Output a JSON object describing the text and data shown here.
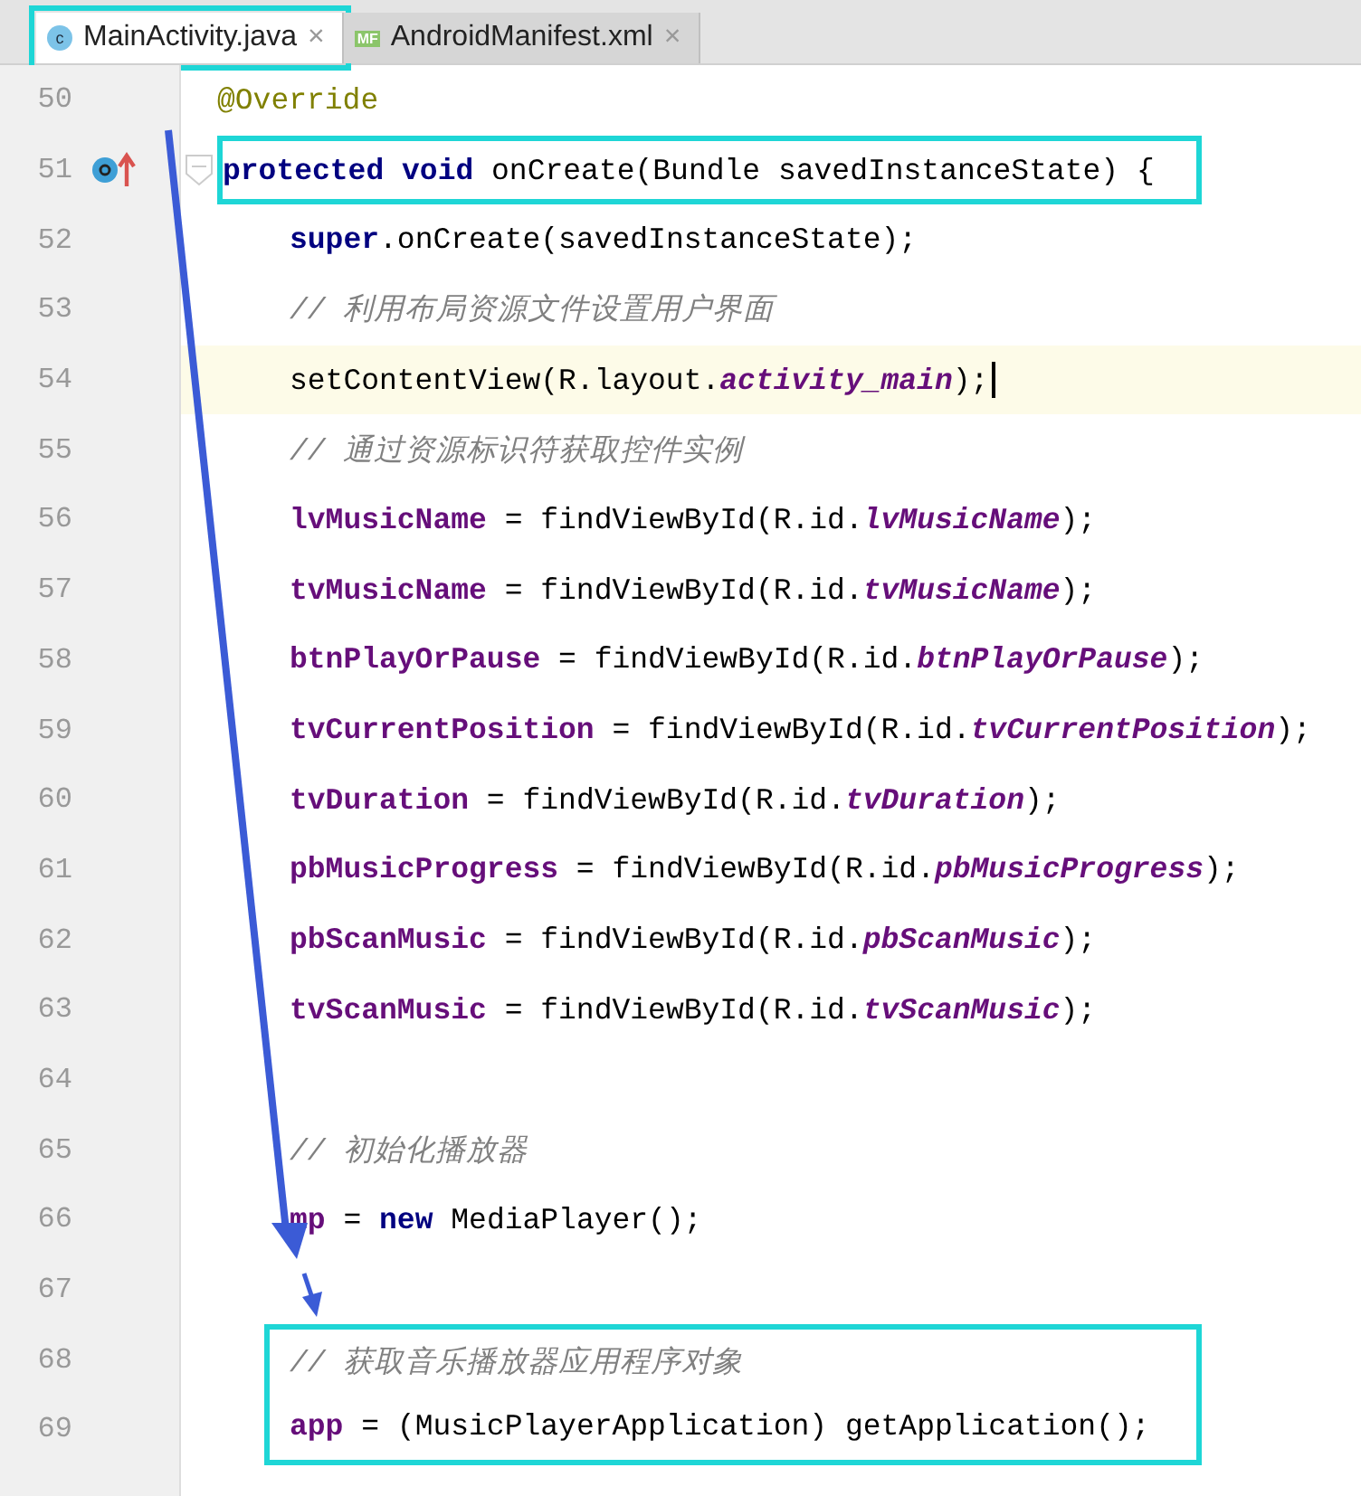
{
  "tabs": [
    {
      "label": "MainActivity.java",
      "badge": "c",
      "close": "×",
      "selected": true,
      "highlighted": true
    },
    {
      "label": "AndroidManifest.xml",
      "badge": "MF",
      "close": "×",
      "selected": false,
      "highlighted": false
    }
  ],
  "lines": [
    {
      "number": "50",
      "tokens": [
        {
          "kind": "annotation",
          "text": "@Override"
        }
      ]
    },
    {
      "number": "51",
      "overridden": true,
      "foldable": true,
      "highlighted": true,
      "tokens": [
        {
          "kind": "kw",
          "text": "protected void "
        },
        {
          "kind": "plain",
          "text": "onCreate(Bundle savedInstanceState) {"
        }
      ],
      "children": [
        {
          "number": "52",
          "tokens": [
            {
              "kind": "kw",
              "text": "super"
            },
            {
              "kind": "plain",
              "text": ".onCreate(savedInstanceState);"
            }
          ]
        },
        {
          "number": "53",
          "tokens": [
            {
              "kind": "comment",
              "text": "// 利用布局资源文件设置用户界面"
            }
          ]
        },
        {
          "number": "54",
          "current": true,
          "tokens": [
            {
              "kind": "plain",
              "text": "setContentView(R.layout."
            },
            {
              "kind": "id",
              "text": "activity_main"
            },
            {
              "kind": "plain",
              "text": ");"
            }
          ]
        },
        {
          "number": "55",
          "tokens": [
            {
              "kind": "comment",
              "text": "// 通过资源标识符获取控件实例"
            }
          ]
        },
        {
          "number": "56",
          "tokens": [
            {
              "kind": "field",
              "text": "lvMusicName"
            },
            {
              "kind": "plain",
              "text": " = findViewById(R.id."
            },
            {
              "kind": "id",
              "text": "lvMusicName"
            },
            {
              "kind": "plain",
              "text": ");"
            }
          ]
        },
        {
          "number": "57",
          "tokens": [
            {
              "kind": "field",
              "text": "tvMusicName"
            },
            {
              "kind": "plain",
              "text": " = findViewById(R.id."
            },
            {
              "kind": "id",
              "text": "tvMusicName"
            },
            {
              "kind": "plain",
              "text": ");"
            }
          ]
        },
        {
          "number": "58",
          "tokens": [
            {
              "kind": "field",
              "text": "btnPlayOrPause"
            },
            {
              "kind": "plain",
              "text": " = findViewById(R.id."
            },
            {
              "kind": "id",
              "text": "btnPlayOrPause"
            },
            {
              "kind": "plain",
              "text": ");"
            }
          ]
        },
        {
          "number": "59",
          "tokens": [
            {
              "kind": "field",
              "text": "tvCurrentPosition"
            },
            {
              "kind": "plain",
              "text": " = findViewById(R.id."
            },
            {
              "kind": "id",
              "text": "tvCurrentPosition"
            },
            {
              "kind": "plain",
              "text": ");"
            }
          ]
        },
        {
          "number": "60",
          "tokens": [
            {
              "kind": "field",
              "text": "tvDuration"
            },
            {
              "kind": "plain",
              "text": " = findViewById(R.id."
            },
            {
              "kind": "id",
              "text": "tvDuration"
            },
            {
              "kind": "plain",
              "text": ");"
            }
          ]
        },
        {
          "number": "61",
          "tokens": [
            {
              "kind": "field",
              "text": "pbMusicProgress"
            },
            {
              "kind": "plain",
              "text": " = findViewById(R.id."
            },
            {
              "kind": "id",
              "text": "pbMusicProgress"
            },
            {
              "kind": "plain",
              "text": ");"
            }
          ]
        },
        {
          "number": "62",
          "tokens": [
            {
              "kind": "field",
              "text": "pbScanMusic"
            },
            {
              "kind": "plain",
              "text": " = findViewById(R.id."
            },
            {
              "kind": "id",
              "text": "pbScanMusic"
            },
            {
              "kind": "plain",
              "text": ");"
            }
          ]
        },
        {
          "number": "63",
          "tokens": [
            {
              "kind": "field",
              "text": "tvScanMusic"
            },
            {
              "kind": "plain",
              "text": " = findViewById(R.id."
            },
            {
              "kind": "id",
              "text": "tvScanMusic"
            },
            {
              "kind": "plain",
              "text": ");"
            }
          ]
        },
        {
          "number": "64"
        },
        {
          "number": "65",
          "tokens": [
            {
              "kind": "comment",
              "text": "// 初始化播放器"
            }
          ]
        },
        {
          "number": "66",
          "tokens": [
            {
              "kind": "field",
              "text": "mp"
            },
            {
              "kind": "plain",
              "text": " = "
            },
            {
              "kind": "kw",
              "text": "new "
            },
            {
              "kind": "plain",
              "text": "MediaPlayer();"
            }
          ]
        },
        {
          "number": "67"
        },
        {
          "number": "68",
          "highlighted": true,
          "tokens": [
            {
              "kind": "comment",
              "text": "// 获取音乐播放器应用程序对象"
            }
          ]
        },
        {
          "number": "69",
          "highlighted": true,
          "tokens": [
            {
              "kind": "field",
              "text": "app"
            },
            {
              "kind": "plain",
              "text": " = (MusicPlayerApplication) getApplication();"
            }
          ]
        }
      ]
    }
  ]
}
